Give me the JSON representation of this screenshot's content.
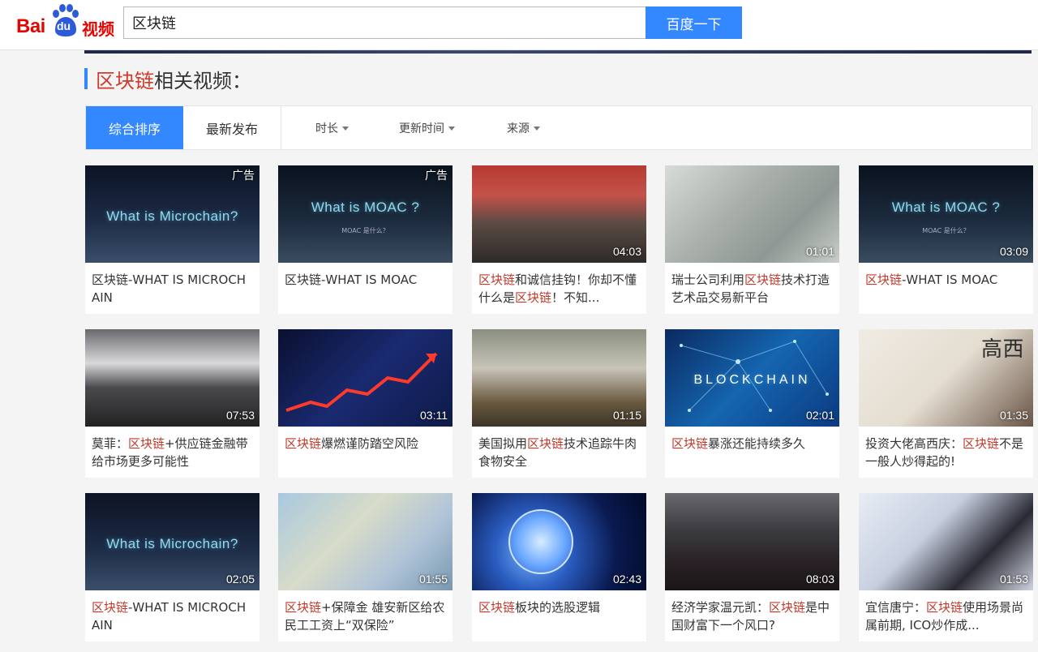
{
  "header": {
    "logo_bai": "Bai",
    "logo_du": "du",
    "logo_video": "视频",
    "search_value": "区块链",
    "search_button": "百度一下"
  },
  "section": {
    "keyword": "区块链",
    "suffix": "相关视频："
  },
  "filters": {
    "tabs": [
      "综合排序",
      "最新发布"
    ],
    "dropdowns": [
      "时长",
      "更新时间",
      "来源"
    ]
  },
  "colors": {
    "accent": "#3388ff",
    "keyword": "#c0392b",
    "brand_red": "#e10601"
  },
  "videos": [
    {
      "badge": "广告",
      "duration": "",
      "thumb_text": "What is Microchain?",
      "thumb_sub": "",
      "title": [
        {
          "t": "区块链-WHAT IS MICROCHAIN",
          "k": false
        }
      ]
    },
    {
      "badge": "广告",
      "duration": "",
      "thumb_text": "What is MOAC ?",
      "thumb_sub": "MOAC 是什么？",
      "title": [
        {
          "t": "区块链-WHAT IS MOAC",
          "k": false
        }
      ]
    },
    {
      "badge": "",
      "duration": "04:03",
      "thumb_text": "",
      "thumb_sub": "",
      "title": [
        {
          "t": "区块链",
          "k": true
        },
        {
          "t": "和诚信挂钩！你却不懂什么是",
          "k": false
        },
        {
          "t": "区块链",
          "k": true
        },
        {
          "t": "！不知...",
          "k": false
        }
      ]
    },
    {
      "badge": "",
      "duration": "01:01",
      "thumb_text": "",
      "thumb_sub": "",
      "title": [
        {
          "t": "瑞士公司利用",
          "k": false
        },
        {
          "t": "区块链",
          "k": true
        },
        {
          "t": "技术打造艺术品交易新平台",
          "k": false
        }
      ]
    },
    {
      "badge": "",
      "duration": "03:09",
      "thumb_text": "What is MOAC ?",
      "thumb_sub": "MOAC 是什么？",
      "title": [
        {
          "t": "区块链",
          "k": true
        },
        {
          "t": "-WHAT IS MOAC",
          "k": false
        }
      ]
    },
    {
      "badge": "",
      "duration": "07:53",
      "thumb_text": "",
      "thumb_sub": "",
      "title": [
        {
          "t": "莫菲：",
          "k": false
        },
        {
          "t": "区块链",
          "k": true
        },
        {
          "t": "+供应链金融带给市场更多可能性",
          "k": false
        }
      ]
    },
    {
      "badge": "",
      "duration": "03:11",
      "thumb_text": "",
      "thumb_sub": "",
      "title": [
        {
          "t": "区块链",
          "k": true
        },
        {
          "t": "爆燃谨防踏空风险",
          "k": false
        }
      ]
    },
    {
      "badge": "",
      "duration": "01:15",
      "thumb_text": "",
      "thumb_sub": "",
      "title": [
        {
          "t": "美国拟用",
          "k": false
        },
        {
          "t": "区块链",
          "k": true
        },
        {
          "t": "技术追踪牛肉食物安全",
          "k": false
        }
      ]
    },
    {
      "badge": "",
      "duration": "02:01",
      "thumb_text": "BLOCKCHAIN",
      "thumb_sub": "",
      "title": [
        {
          "t": "区块链",
          "k": true
        },
        {
          "t": "暴涨还能持续多久",
          "k": false
        }
      ]
    },
    {
      "badge": "",
      "duration": "01:35",
      "thumb_text": "高西",
      "thumb_sub": "",
      "title": [
        {
          "t": "投资大佬高西庆：",
          "k": false
        },
        {
          "t": "区块链",
          "k": true
        },
        {
          "t": "不是一般人炒得起的!",
          "k": false
        }
      ]
    },
    {
      "badge": "",
      "duration": "02:05",
      "thumb_text": "What is Microchain?",
      "thumb_sub": "",
      "title": [
        {
          "t": "区块链",
          "k": true
        },
        {
          "t": "-WHAT IS MICROCHAIN",
          "k": false
        }
      ]
    },
    {
      "badge": "",
      "duration": "01:55",
      "thumb_text": "",
      "thumb_sub": "",
      "title": [
        {
          "t": "区块链",
          "k": true
        },
        {
          "t": "+保障金 雄安新区给农民工工资上“双保险”",
          "k": false
        }
      ]
    },
    {
      "badge": "",
      "duration": "02:43",
      "thumb_text": "",
      "thumb_sub": "",
      "title": [
        {
          "t": "区块链",
          "k": true
        },
        {
          "t": "板块的选股逻辑",
          "k": false
        }
      ]
    },
    {
      "badge": "",
      "duration": "08:03",
      "thumb_text": "",
      "thumb_sub": "",
      "title": [
        {
          "t": "经济学家温元凯：",
          "k": false
        },
        {
          "t": "区块链",
          "k": true
        },
        {
          "t": "是中国财富下一个风口?",
          "k": false
        }
      ]
    },
    {
      "badge": "",
      "duration": "01:53",
      "thumb_text": "",
      "thumb_sub": "",
      "title": [
        {
          "t": "宜信唐宁：",
          "k": false
        },
        {
          "t": "区块链",
          "k": true
        },
        {
          "t": "使用场景尚属前期, ICO炒作成...",
          "k": false
        }
      ]
    }
  ]
}
